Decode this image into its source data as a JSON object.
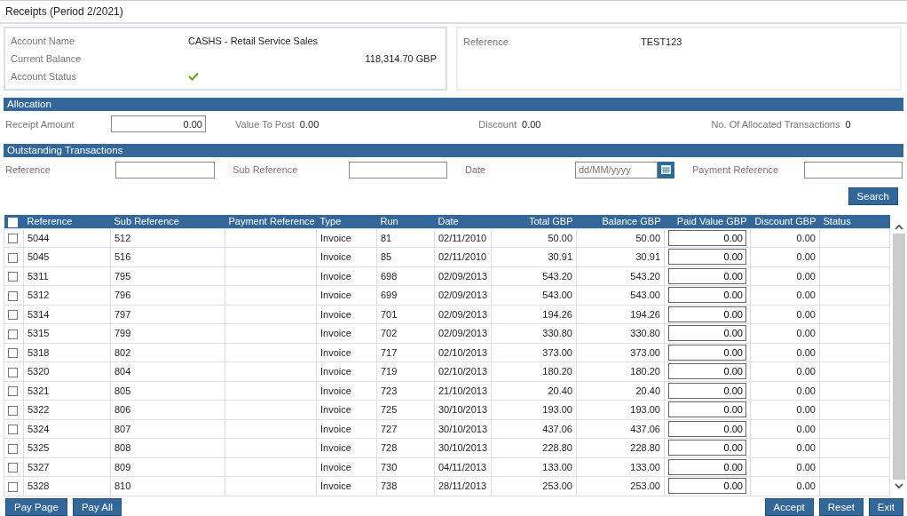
{
  "window": {
    "title": "Receipts (Period 2/2021)"
  },
  "account": {
    "fields": [
      {
        "label": "Account Name",
        "value": "CASHS - Retail Service Sales",
        "kind": "text"
      },
      {
        "label": "Current Balance",
        "value": "118,314.70 GBP",
        "kind": "amount"
      },
      {
        "label": "Account Status",
        "kind": "status",
        "ok": true
      }
    ]
  },
  "reference": {
    "label": "Reference",
    "value": "TEST123"
  },
  "allocation": {
    "title": "Allocation",
    "receipt_amount": {
      "label": "Receipt Amount",
      "value": "0.00"
    },
    "stats": [
      {
        "label": "Value To Post",
        "value": "0.00"
      },
      {
        "label": "Discount",
        "value": "0.00"
      },
      {
        "label": "No. Of Allocated Transactions",
        "value": "0"
      }
    ]
  },
  "outstanding": {
    "title": "Outstanding Transactions",
    "filters": [
      {
        "label": "Reference",
        "kind": "text"
      },
      {
        "label": "Sub Reference",
        "kind": "text"
      },
      {
        "label": "Date",
        "kind": "date",
        "placeholder": "dd/MM/yyyy"
      },
      {
        "label": "Payment Reference",
        "kind": "text"
      }
    ],
    "search_button": "Search"
  },
  "table": {
    "all_checked": false,
    "columns": [
      "Reference",
      "Sub Reference",
      "Payment Reference",
      "Type",
      "Run",
      "Date",
      "Total GBP",
      "Balance GBP",
      "Paid Value GBP",
      "Discount GBP",
      "Status"
    ],
    "rows": [
      {
        "checked": false,
        "cells": [
          "5044",
          "512",
          "",
          "Invoice",
          "81",
          "02/11/2010",
          "50.00",
          "50.00",
          "0.00",
          "0.00",
          ""
        ]
      },
      {
        "checked": false,
        "cells": [
          "5045",
          "516",
          "",
          "Invoice",
          "85",
          "02/11/2010",
          "30.91",
          "30.91",
          "0.00",
          "0.00",
          ""
        ]
      },
      {
        "checked": false,
        "cells": [
          "5311",
          "795",
          "",
          "Invoice",
          "698",
          "02/09/2013",
          "543.20",
          "543.20",
          "0.00",
          "0.00",
          ""
        ]
      },
      {
        "checked": false,
        "cells": [
          "5312",
          "796",
          "",
          "Invoice",
          "699",
          "02/09/2013",
          "543.00",
          "543.00",
          "0.00",
          "0.00",
          ""
        ]
      },
      {
        "checked": false,
        "cells": [
          "5314",
          "797",
          "",
          "Invoice",
          "701",
          "02/09/2013",
          "194.26",
          "194.26",
          "0.00",
          "0.00",
          ""
        ]
      },
      {
        "checked": false,
        "cells": [
          "5315",
          "799",
          "",
          "Invoice",
          "702",
          "02/09/2013",
          "330.80",
          "330.80",
          "0.00",
          "0.00",
          ""
        ]
      },
      {
        "checked": false,
        "cells": [
          "5318",
          "802",
          "",
          "Invoice",
          "717",
          "02/10/2013",
          "373.00",
          "373.00",
          "0.00",
          "0.00",
          ""
        ]
      },
      {
        "checked": false,
        "cells": [
          "5320",
          "804",
          "",
          "Invoice",
          "719",
          "02/10/2013",
          "180.20",
          "180.20",
          "0.00",
          "0.00",
          ""
        ]
      },
      {
        "checked": false,
        "cells": [
          "5321",
          "805",
          "",
          "Invoice",
          "723",
          "21/10/2013",
          "20.40",
          "20.40",
          "0.00",
          "0.00",
          ""
        ]
      },
      {
        "checked": false,
        "cells": [
          "5322",
          "806",
          "",
          "Invoice",
          "725",
          "30/10/2013",
          "193.00",
          "193.00",
          "0.00",
          "0.00",
          ""
        ]
      },
      {
        "checked": false,
        "cells": [
          "5324",
          "807",
          "",
          "Invoice",
          "727",
          "30/10/2013",
          "437.06",
          "437.06",
          "0.00",
          "0.00",
          ""
        ]
      },
      {
        "checked": false,
        "cells": [
          "5325",
          "808",
          "",
          "Invoice",
          "728",
          "30/10/2013",
          "228.80",
          "228.80",
          "0.00",
          "0.00",
          ""
        ]
      },
      {
        "checked": false,
        "cells": [
          "5327",
          "809",
          "",
          "Invoice",
          "730",
          "04/11/2013",
          "133.00",
          "133.00",
          "0.00",
          "0.00",
          ""
        ]
      },
      {
        "checked": false,
        "cells": [
          "5328",
          "810",
          "",
          "Invoice",
          "738",
          "28/11/2013",
          "253.00",
          "253.00",
          "0.00",
          "0.00",
          ""
        ]
      }
    ]
  },
  "footer": {
    "left_buttons": [
      "Pay Page",
      "Pay All"
    ],
    "right_buttons": [
      "Accept",
      "Reset",
      "Exit"
    ]
  }
}
